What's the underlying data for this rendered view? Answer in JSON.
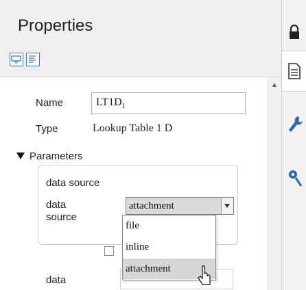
{
  "panel": {
    "title": "Properties"
  },
  "toolbar": {
    "buttons": [
      {
        "icon": "comment-view-icon"
      },
      {
        "icon": "text-view-icon"
      }
    ]
  },
  "fields": {
    "name_label": "Name",
    "name_value": "LT1D",
    "name_subscript": "1",
    "type_label": "Type",
    "type_value": "Lookup Table 1 D"
  },
  "parameters": {
    "header": "Parameters",
    "group_title": "data source",
    "data_source_label_line1": "data",
    "data_source_label_line2": "source",
    "selected_value": "attachment",
    "options": [
      "file",
      "inline",
      "attachment"
    ],
    "highlighted_option": "attachment",
    "next_field_label": "data"
  },
  "side_rail": {
    "icons": [
      "lock-icon",
      "document-icon",
      "wrench-icon",
      "settings-link-icon"
    ]
  },
  "colors": {
    "accent": "#3a78c9",
    "header_bg": "#efefef",
    "selection_bg": "#d6d6d6",
    "wrench": "#2b6cb0"
  }
}
